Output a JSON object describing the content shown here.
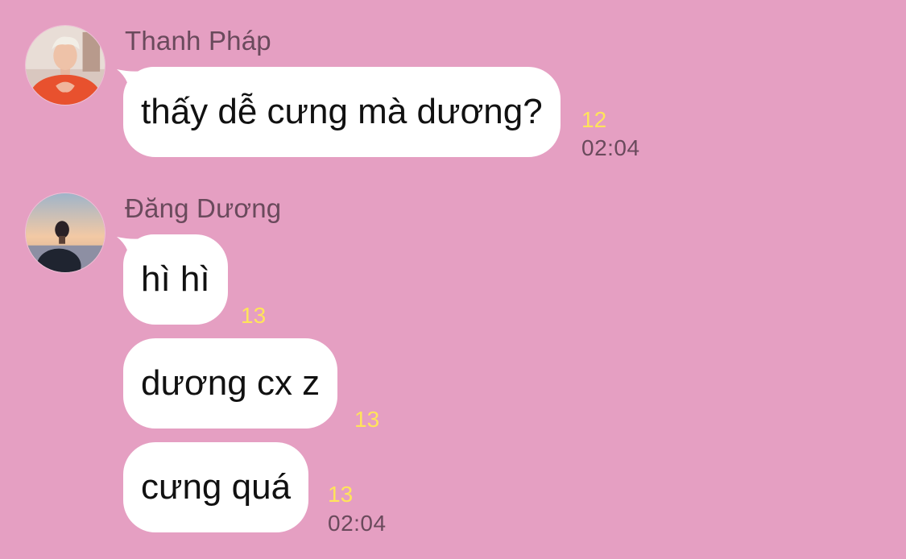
{
  "chat": {
    "messages": [
      {
        "sender": "Thanh Pháp",
        "avatar_icon": "avatar-thanh-phap",
        "bubbles": [
          {
            "text": "thấy dễ cưng mà dương?",
            "read_count": "12",
            "time": "02:04"
          }
        ]
      },
      {
        "sender": "Đăng Dương",
        "avatar_icon": "avatar-dang-duong",
        "bubbles": [
          {
            "text": "hì hì",
            "read_count": "13",
            "time": ""
          },
          {
            "text": "dương cx z",
            "read_count": "13",
            "time": ""
          },
          {
            "text": "cưng quá",
            "read_count": "13",
            "time": "02:04"
          }
        ]
      }
    ]
  },
  "colors": {
    "background": "#e59fc2",
    "bubble": "#ffffff",
    "read_count": "#ffe45a",
    "meta_text": "#6a4a5c"
  }
}
